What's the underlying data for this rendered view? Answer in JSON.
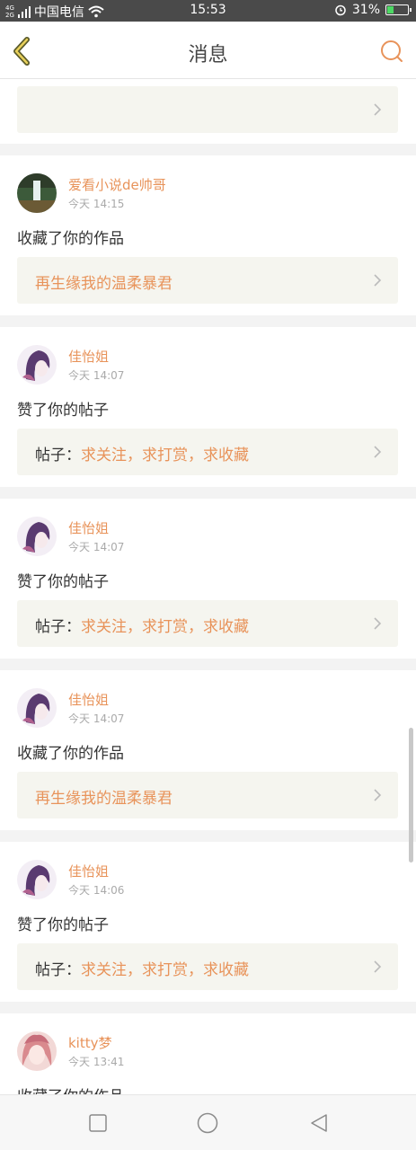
{
  "status_bar": {
    "network_small": "4G\n2G",
    "carrier": "中国电信",
    "time": "15:53",
    "battery_percent": "31%",
    "battery_level": 0.31
  },
  "header": {
    "title": "消息",
    "back_icon": "chevron-left-icon",
    "search_icon": "search-icon",
    "accent_color": "#e8935a"
  },
  "notifications": [
    {
      "username": "",
      "time": "",
      "action": "",
      "ref_prefix": "",
      "ref_text": ""
    },
    {
      "username": "爱看小说de帅哥",
      "time": "今天 14:15",
      "action": "收藏了你的作品",
      "ref_prefix": "",
      "ref_text": "再生缘我的温柔暴君"
    },
    {
      "username": "佳怡姐",
      "time": "今天 14:07",
      "action": "赞了你的帖子",
      "ref_prefix": "帖子：",
      "ref_text": "求关注，求打赏，求收藏"
    },
    {
      "username": "佳怡姐",
      "time": "今天 14:07",
      "action": "赞了你的帖子",
      "ref_prefix": "帖子：",
      "ref_text": "求关注，求打赏，求收藏"
    },
    {
      "username": "佳怡姐",
      "time": "今天 14:07",
      "action": "收藏了你的作品",
      "ref_prefix": "",
      "ref_text": "再生缘我的温柔暴君"
    },
    {
      "username": "佳怡姐",
      "time": "今天 14:06",
      "action": "赞了你的帖子",
      "ref_prefix": "帖子：",
      "ref_text": "求关注，求打赏，求收藏"
    },
    {
      "username": "kitty梦",
      "time": "今天 13:41",
      "action": "收藏了你的作品",
      "ref_prefix": "",
      "ref_text": ""
    }
  ],
  "nav_bar": {
    "recents_icon": "square-icon",
    "home_icon": "circle-icon",
    "back_icon": "triangle-back-icon"
  }
}
